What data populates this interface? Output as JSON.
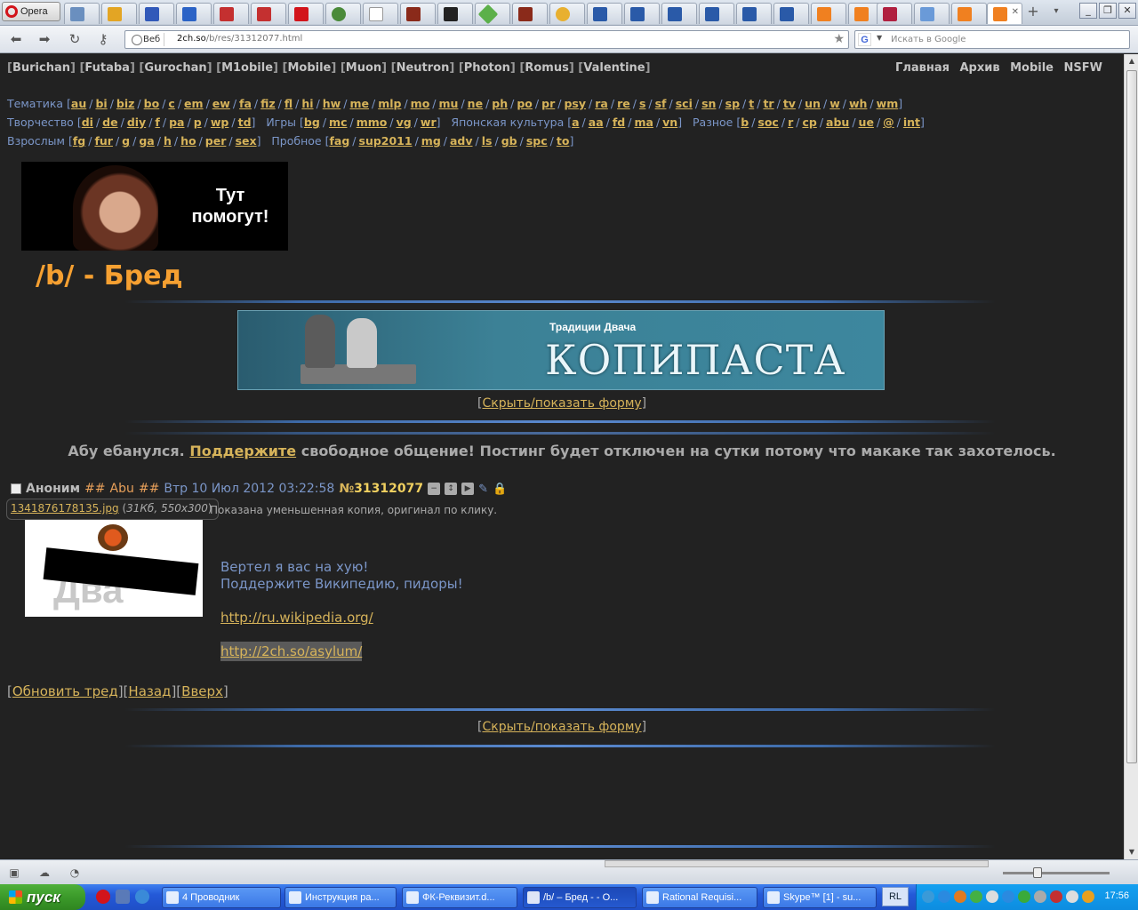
{
  "browser": {
    "menu_label": "Opera",
    "address_badge": "Веб",
    "url_host": "2ch.so",
    "url_path": "/b/res/31312077.html",
    "search_placeholder": "Искать в Google",
    "search_engine_letter": "G"
  },
  "header": {
    "chans": [
      "Burichan",
      "Futaba",
      "Gurochan",
      "M1obile",
      "Mobile",
      "Muon",
      "Neutron",
      "Photon",
      "Romus",
      "Valentine"
    ],
    "right_links": [
      "Главная",
      "Архив",
      "Mobile",
      "NSFW"
    ]
  },
  "boards": {
    "row1": {
      "cat1": "Тематика",
      "cat1_items": [
        "au",
        "bi",
        "biz",
        "bo",
        "c",
        "em",
        "ew",
        "fa",
        "fiz",
        "fl",
        "hi",
        "hw",
        "me",
        "mlp",
        "mo",
        "mu",
        "ne",
        "ph",
        "po",
        "pr",
        "psy",
        "ra",
        "re",
        "s",
        "sf",
        "sci",
        "sn",
        "sp",
        "t",
        "tr",
        "tv",
        "un",
        "w",
        "wh",
        "wm"
      ]
    },
    "row2": {
      "cat1": "Творчество",
      "cat1_items": [
        "di",
        "de",
        "diy",
        "f",
        "pa",
        "p",
        "wp",
        "td"
      ],
      "cat2": "Игры",
      "cat2_items": [
        "bg",
        "mc",
        "mmo",
        "vg",
        "wr"
      ],
      "cat3": "Японская культура",
      "cat3_items": [
        "a",
        "aa",
        "fd",
        "ma",
        "vn"
      ],
      "cat4": "Разное",
      "cat4_items": [
        "b",
        "soc",
        "r",
        "cp",
        "abu",
        "ue",
        "@",
        "int"
      ]
    },
    "row3": {
      "cat1": "Взрослым",
      "cat1_items": [
        "fg",
        "fur",
        "g",
        "ga",
        "h",
        "ho",
        "per",
        "sex"
      ],
      "cat2": "Пробное",
      "cat2_items": [
        "fag",
        "sup2011",
        "mg",
        "adv",
        "ls",
        "gb",
        "spc",
        "to"
      ]
    }
  },
  "logo": {
    "text_line1": "Тут",
    "text_line2": "помогут!"
  },
  "board_title": "/b/ - Бред",
  "banner": {
    "sub": "Традиции Двача",
    "big": "КОПИПАСТА"
  },
  "form_toggle": "Скрыть/показать форму",
  "announcement": {
    "before": "Абу ебанулся.",
    "link": "Поддержите",
    "after": "свободное общение! Постинг будет отключен на сутки потому что макаке так захотелось."
  },
  "post": {
    "name": "Аноним",
    "trip_prefix": "##",
    "trip_name": "Abu",
    "trip_suffix": "##",
    "date": "Втр 10 Июл 2012 03:22:58",
    "number_prefix": "№",
    "number": "31312077",
    "file_name": "1341876178135.jpg",
    "file_meta": "31Кб, 550x300",
    "file_note": "Показана уменьшенная копия, оригинал по клику.",
    "thumb_text": "Два",
    "lines": [
      "Вертел я вас на хую!",
      "Поддержите Википедию, пидоры!"
    ],
    "link1": "http://ru.wikipedia.org/",
    "link2": "http://2ch.so/asylum/"
  },
  "thread_nav": [
    "Обновить тред",
    "Назад",
    "Вверх"
  ],
  "taskbar": {
    "start": "пуск",
    "tasks": [
      {
        "label": "4 Проводник"
      },
      {
        "label": "Инструкция ра..."
      },
      {
        "label": "ФК-Реквизит.d..."
      },
      {
        "label": "/b/ – Бред - - O..."
      },
      {
        "label": "Rational Requisi..."
      },
      {
        "label": "Skype™ [1] - su..."
      }
    ],
    "lang": "RL",
    "clock": "17:56"
  },
  "colors": {
    "accent": "#f6a031",
    "link": "#d6b35a",
    "blue_text": "#7b96c8",
    "bg": "#222222"
  }
}
